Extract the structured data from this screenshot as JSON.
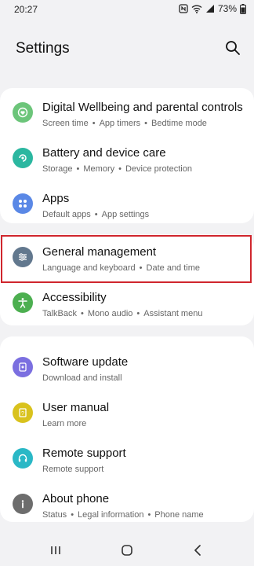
{
  "status": {
    "time": "20:27",
    "battery": "73%"
  },
  "header": {
    "title": "Settings"
  },
  "groups": [
    {
      "items": [
        {
          "label": "Digital Wellbeing and parental controls",
          "sub": [
            "Screen time",
            "App timers",
            "Bedtime mode"
          ],
          "icon": "wellbeing-icon",
          "color": "#6cc57a"
        },
        {
          "label": "Battery and device care",
          "sub": [
            "Storage",
            "Memory",
            "Device protection"
          ],
          "icon": "device-care-icon",
          "color": "#2bb7a0"
        },
        {
          "label": "Apps",
          "sub": [
            "Default apps",
            "App settings"
          ],
          "icon": "apps-icon",
          "color": "#5a88e6"
        }
      ]
    },
    {
      "items": [
        {
          "label": "General management",
          "sub": [
            "Language and keyboard",
            "Date and time"
          ],
          "icon": "sliders-icon",
          "color": "#62788e"
        },
        {
          "label": "Accessibility",
          "sub": [
            "TalkBack",
            "Mono audio",
            "Assistant menu"
          ],
          "icon": "accessibility-icon",
          "color": "#4caf50"
        }
      ]
    },
    {
      "items": [
        {
          "label": "Software update",
          "sub": [
            "Download and install"
          ],
          "icon": "software-update-icon",
          "color": "#7b6fe0"
        },
        {
          "label": "User manual",
          "sub": [
            "Learn more"
          ],
          "icon": "manual-icon",
          "color": "#d9c21d"
        },
        {
          "label": "Remote support",
          "sub": [
            "Remote support"
          ],
          "icon": "headset-icon",
          "color": "#2ab8c6"
        },
        {
          "label": "About phone",
          "sub": [
            "Status",
            "Legal information",
            "Phone name"
          ],
          "icon": "info-icon",
          "color": "#6d6d6d"
        }
      ]
    }
  ]
}
